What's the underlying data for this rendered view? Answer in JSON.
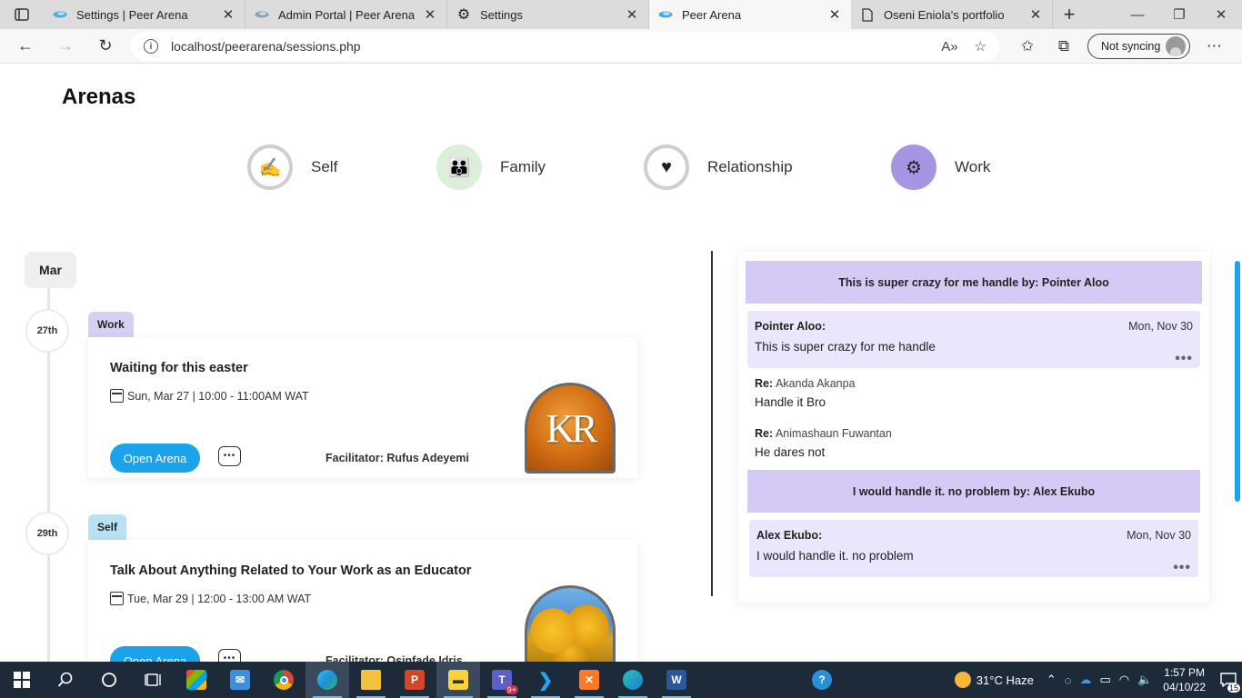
{
  "browser": {
    "tabs": [
      {
        "title": "Settings | Peer Arena",
        "icon": "peer-arena-logo",
        "active": false
      },
      {
        "title": "Admin Portal | Peer Arena",
        "icon": "peer-arena-logo",
        "active": false
      },
      {
        "title": "Settings",
        "icon": "gear-icon",
        "active": false
      },
      {
        "title": "Peer Arena",
        "icon": "peer-arena-logo",
        "active": true
      },
      {
        "title": "Oseni Eniola's portfolio",
        "icon": "document-icon",
        "active": false
      }
    ],
    "url": "localhost/peerarena/sessions.php",
    "sync_label": "Not syncing"
  },
  "page": {
    "title": "Arenas",
    "categories": [
      {
        "label": "Self",
        "style": "grey"
      },
      {
        "label": "Family",
        "style": "green"
      },
      {
        "label": "Relationship",
        "style": "grey"
      },
      {
        "label": "Work",
        "style": "purple"
      }
    ],
    "month": "Mar",
    "sessions": [
      {
        "day": "27th",
        "category": "Work",
        "title": "Waiting for this easter",
        "datetime": "Sun, Mar 27 | 10:00 - 11:00AM WAT",
        "open_label": "Open Arena",
        "facilitator": "Facilitator: Rufus Adeyemi",
        "image_text": "KR"
      },
      {
        "day": "29th",
        "category": "Self",
        "title": "Talk About Anything Related to Your Work as an Educator",
        "datetime": "Tue, Mar 29 | 12:00 - 13:00 AM WAT",
        "open_label": "Open Arena",
        "facilitator": "Facilitator: Osinfade Idris"
      }
    ]
  },
  "discussion": {
    "threads": [
      {
        "heading": "This is super crazy for me handle by: Pointer Aloo",
        "author": "Pointer Aloo:",
        "date": "Mon, Nov 30",
        "message": "This is super crazy for me handle",
        "replies": [
          {
            "prefix": "Re:",
            "by": "Akanda Akanpa",
            "text": "Handle it Bro"
          },
          {
            "prefix": "Re:",
            "by": "Animashaun Fuwantan",
            "text": "He dares not"
          }
        ]
      },
      {
        "heading": "I would handle it. no problem by: Alex Ekubo",
        "author": "Alex Ekubo:",
        "date": "Mon, Nov 30",
        "message": "I would handle it. no problem",
        "replies": []
      }
    ]
  },
  "taskbar": {
    "weather": "31°C  Haze",
    "time": "1:57 PM",
    "date": "04/10/22",
    "notification_count": "15",
    "teams_badge": "9+"
  }
}
